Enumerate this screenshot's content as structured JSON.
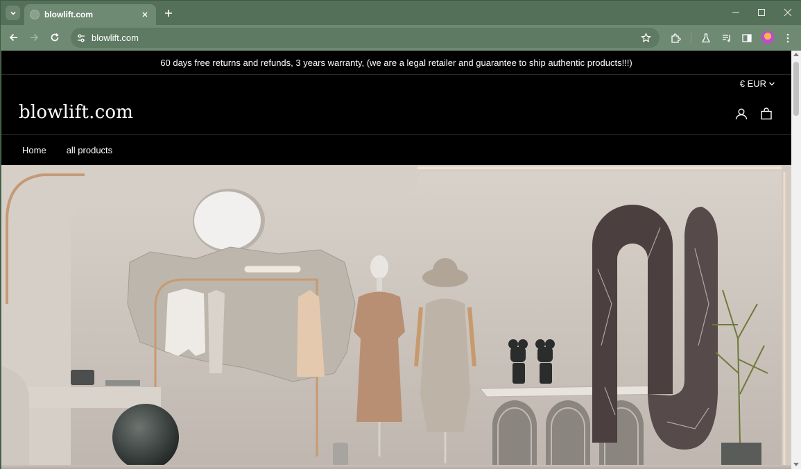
{
  "browser": {
    "tab_title": "blowlift.com",
    "url": "blowlift.com"
  },
  "store": {
    "announcement": "60 days free returns and refunds, 3 years warranty, (we are a legal retailer and guarantee to ship authentic products!!!)",
    "currency": "€ EUR",
    "logo": "blowlift.com",
    "nav": [
      {
        "label": "Home"
      },
      {
        "label": "all products"
      }
    ]
  },
  "icons": {
    "tab_search": "chevron-down-icon",
    "new_tab": "plus-icon",
    "back": "arrow-left-icon",
    "forward": "arrow-right-icon",
    "reload": "reload-icon",
    "site_info": "tune-icon",
    "bookmark": "star-icon",
    "extensions": "puzzle-icon",
    "labs": "flask-icon",
    "media": "queue-music-icon",
    "side_panel": "side-panel-icon",
    "menu": "kebab-menu-icon",
    "account": "user-icon",
    "cart": "shopping-bag-icon"
  },
  "colors": {
    "browser_frame": "#557059",
    "toolbar": "#6f8a73",
    "page_header": "#000000",
    "hero_wall": "#cfc8c1"
  }
}
